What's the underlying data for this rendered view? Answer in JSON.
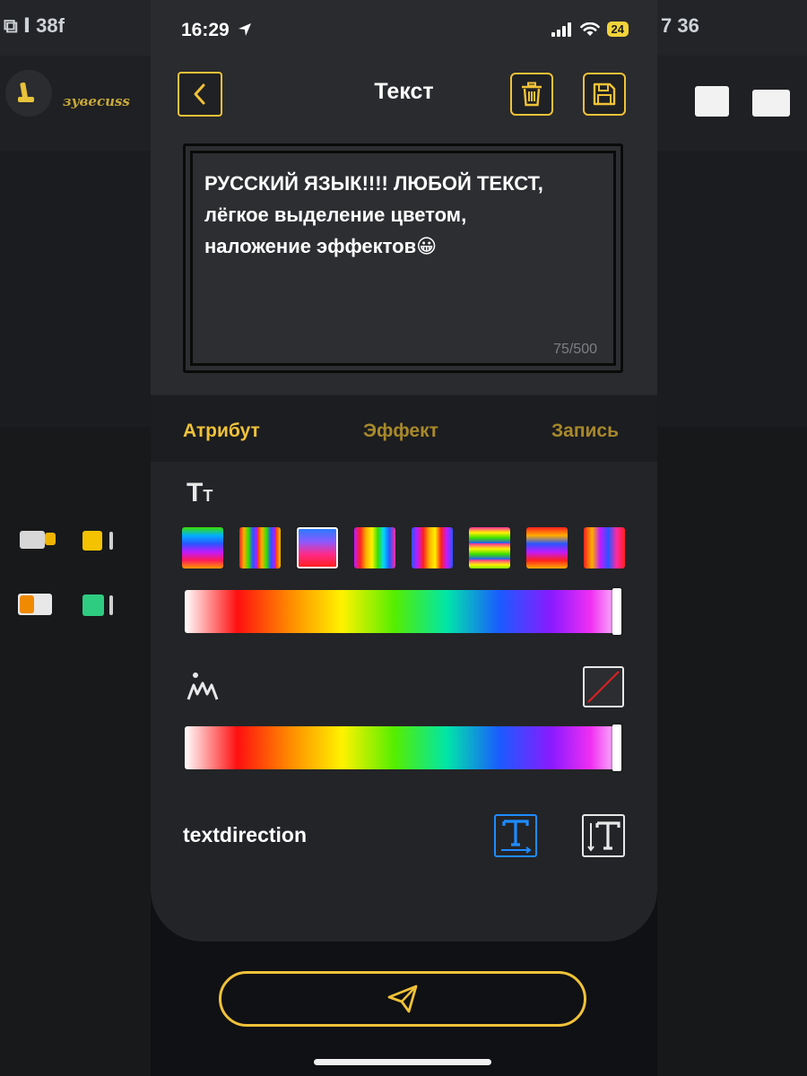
{
  "background": {
    "left_time": "⧉ Ⅰ 38f",
    "left_app_label": "зувеcuss",
    "right_time": "7 36"
  },
  "status_bar": {
    "time": "16:29",
    "battery": "24",
    "location_icon": "location-arrow-icon",
    "signal_icon": "cellular-signal-icon",
    "wifi_icon": "wifi-icon"
  },
  "header": {
    "title": "Текст",
    "back_icon": "chevron-left-icon",
    "delete_icon": "trash-icon",
    "save_icon": "floppy-save-icon"
  },
  "editor": {
    "text": "РУССКИЙ ЯЗЫК!!!! ЛЮБОЙ ТЕКСТ,\nлёгкое выделение цветом,\nналожение эффектов😀",
    "counter": "75/500"
  },
  "tabs": [
    {
      "label": "Атрибут",
      "active": true
    },
    {
      "label": "Эффект",
      "active": false
    },
    {
      "label": "Запись",
      "active": false
    }
  ],
  "attributes": {
    "text_color_section_icon": "Tt",
    "gradient_swatches_count": 8,
    "selected_swatch_index": 2,
    "text_color_slider_position": 1.0,
    "stroke_section_icon": "stroke-width-icon",
    "stroke_none_icon": "no-color-icon",
    "stroke_color_slider_position": 1.0
  },
  "text_direction": {
    "label": "textdirection",
    "horizontal_icon": "text-horizontal-icon",
    "vertical_icon": "text-vertical-icon",
    "selected": "horizontal"
  },
  "send_button": {
    "icon": "send-paper-plane-icon"
  },
  "colors": {
    "accent_gold": "#f0c238",
    "tab_inactive": "#a8892a",
    "selected_blue": "#1e8cff",
    "panel": "#2a2b2e"
  }
}
